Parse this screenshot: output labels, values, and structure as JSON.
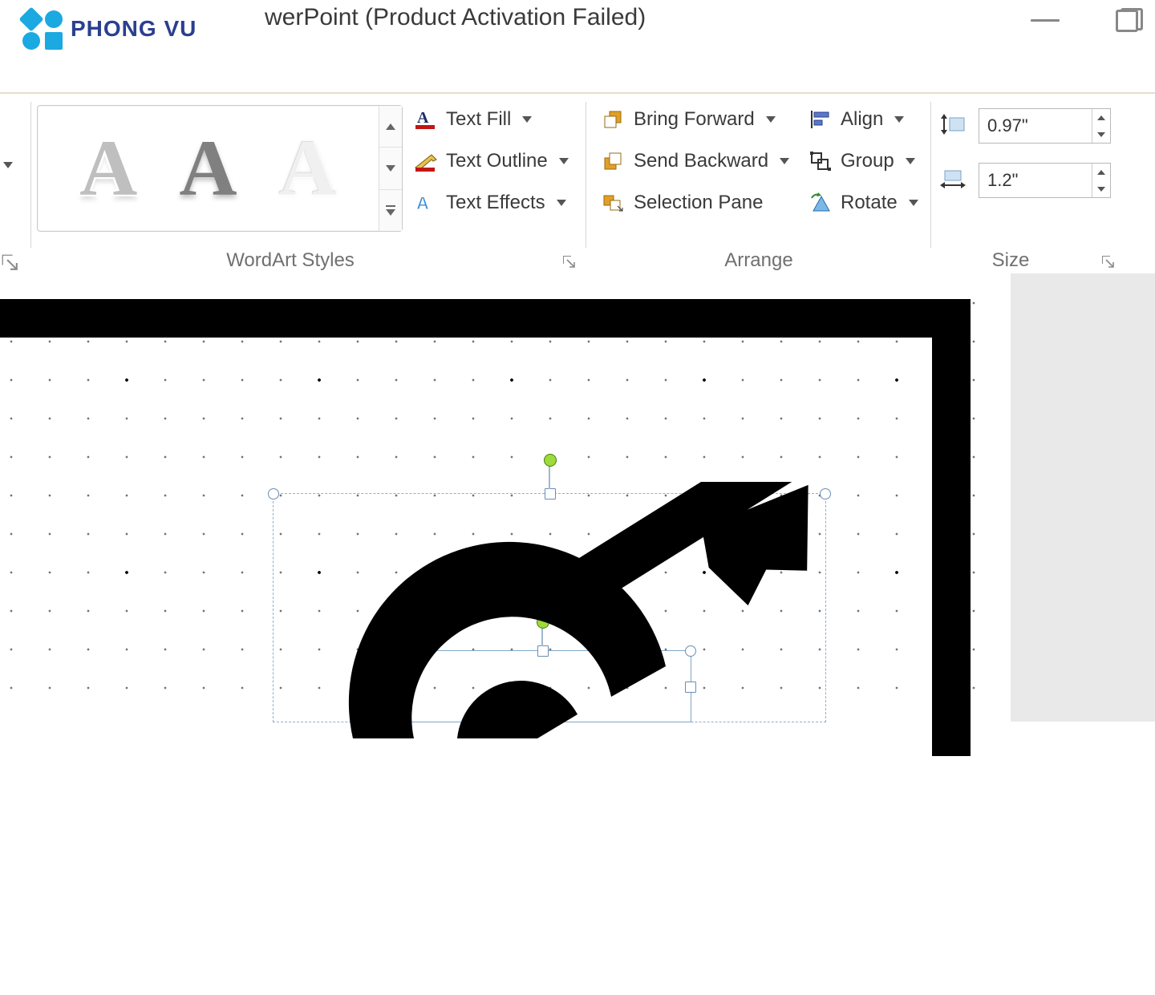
{
  "brand": "PHONG VU",
  "title": "werPoint (Product Activation Failed)",
  "ribbon": {
    "text_fill": "Text Fill",
    "text_outline": "Text Outline",
    "text_effects": "Text Effects",
    "bring_forward": "Bring Forward",
    "send_backward": "Send Backward",
    "selection_pane": "Selection Pane",
    "align": "Align",
    "group": "Group",
    "rotate": "Rotate",
    "group_wordart": "WordArt Styles",
    "group_arrange": "Arrange",
    "group_size": "Size",
    "height": "0.97\"",
    "width": "1.2\""
  }
}
